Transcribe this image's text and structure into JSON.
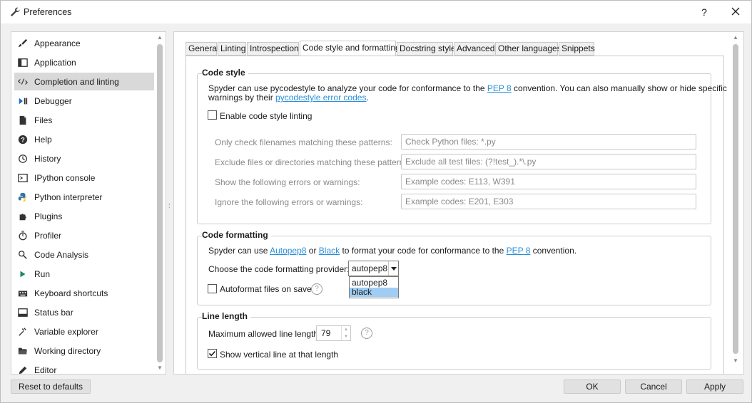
{
  "window": {
    "title": "Preferences",
    "help_label": "?",
    "close_label": "✕"
  },
  "sidebar": {
    "items": [
      {
        "label": "Appearance",
        "icon": "paintbrush-icon"
      },
      {
        "label": "Application",
        "icon": "window-layout-icon"
      },
      {
        "label": "Completion and linting",
        "icon": "code-completion-icon",
        "selected": true
      },
      {
        "label": "Debugger",
        "icon": "debug-step-icon"
      },
      {
        "label": "Files",
        "icon": "file-icon"
      },
      {
        "label": "Help",
        "icon": "help-circle-icon"
      },
      {
        "label": "History",
        "icon": "history-clock-icon"
      },
      {
        "label": "IPython console",
        "icon": "terminal-icon"
      },
      {
        "label": "Python interpreter",
        "icon": "python-logo-icon"
      },
      {
        "label": "Plugins",
        "icon": "puzzle-icon"
      },
      {
        "label": "Profiler",
        "icon": "stopwatch-icon"
      },
      {
        "label": "Code Analysis",
        "icon": "magnifier-check-icon"
      },
      {
        "label": "Run",
        "icon": "play-icon"
      },
      {
        "label": "Keyboard shortcuts",
        "icon": "keyboard-icon"
      },
      {
        "label": "Status bar",
        "icon": "statusbar-icon"
      },
      {
        "label": "Variable explorer",
        "icon": "variable-icon"
      },
      {
        "label": "Working directory",
        "icon": "folder-open-icon"
      },
      {
        "label": "Editor",
        "icon": "pencil-icon"
      }
    ]
  },
  "tabs": [
    "General",
    "Linting",
    "Introspection",
    "Code style and formatting",
    "Docstring style",
    "Advanced",
    "Other languages",
    "Snippets"
  ],
  "active_tab": "Code style and formatting",
  "code_style": {
    "title": "Code style",
    "desc_line1_a": "Spyder can use pycodestyle to analyze your code for conformance to the ",
    "desc_line1_link": "PEP 8",
    "desc_line1_b": " convention. You can also manually show or hide specific",
    "desc_line2_a": "warnings by their ",
    "desc_line2_link": "pycodestyle error codes",
    "desc_line2_b": ".",
    "enable_label": "Enable code style linting",
    "enable_checked": false,
    "fields": [
      {
        "label": "Only check filenames matching these patterns:",
        "placeholder": "Check Python files: *.py"
      },
      {
        "label": "Exclude files or directories matching these patterns:",
        "placeholder": "Exclude all test files: (?!test_).*\\.py"
      },
      {
        "label": "Show the following errors or warnings:",
        "placeholder": "Example codes: E113, W391"
      },
      {
        "label": "Ignore the following errors or warnings:",
        "placeholder": "Example codes: E201, E303"
      }
    ]
  },
  "code_formatting": {
    "title": "Code formatting",
    "desc_a": "Spyder can use ",
    "link_autopep8": "Autopep8",
    "desc_or": " or ",
    "link_black": "Black",
    "desc_b": " to format your code for conformance to the ",
    "link_pep8": "PEP 8",
    "desc_c": " convention.",
    "provider_label": "Choose the code formatting provider:",
    "provider_value": "autopep8",
    "provider_options": [
      "autopep8",
      "black"
    ],
    "highlighted_option": "black",
    "autoformat_label": "Autoformat files on save",
    "autoformat_checked": false,
    "help_mark": "?"
  },
  "line_length": {
    "title": "Line length",
    "max_label": "Maximum allowed line length:",
    "max_value": "79",
    "help_mark": "?",
    "show_line_label": "Show vertical line at that length",
    "show_line_checked": true
  },
  "footer": {
    "reset_label": "Reset to defaults",
    "ok_label": "OK",
    "cancel_label": "Cancel",
    "apply_label": "Apply"
  }
}
